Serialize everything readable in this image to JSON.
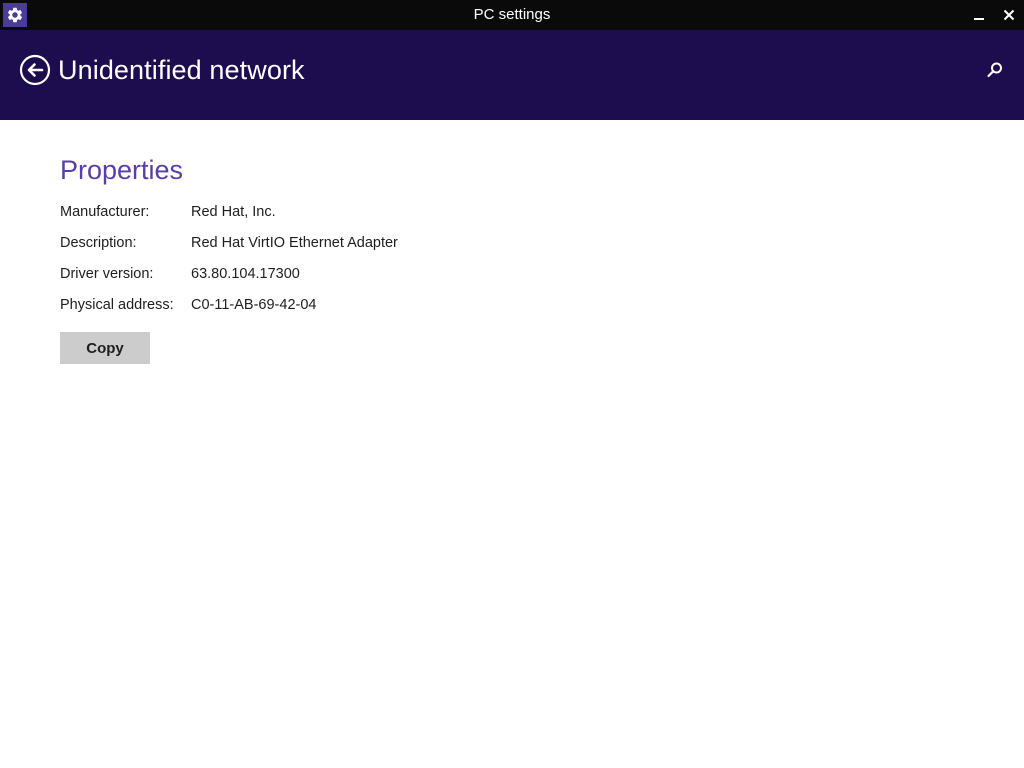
{
  "window": {
    "title": "PC settings",
    "icon": "gear-icon",
    "controls": [
      "minimize",
      "close"
    ]
  },
  "header": {
    "title": "Unidentified network",
    "back_icon": "back-arrow-icon",
    "search_icon": "search-icon",
    "color": "#1d0c4e"
  },
  "main": {
    "section_title": "Properties",
    "accent_color": "#5a3ea8",
    "properties": [
      {
        "label": "Manufacturer:",
        "value": "Red Hat, Inc."
      },
      {
        "label": "Description:",
        "value": "Red Hat VirtIO Ethernet Adapter"
      },
      {
        "label": "Driver version:",
        "value": "63.80.104.17300"
      },
      {
        "label": "Physical address:",
        "value": "C0-11-AB-69-42-04"
      }
    ],
    "copy_label": "Copy"
  }
}
